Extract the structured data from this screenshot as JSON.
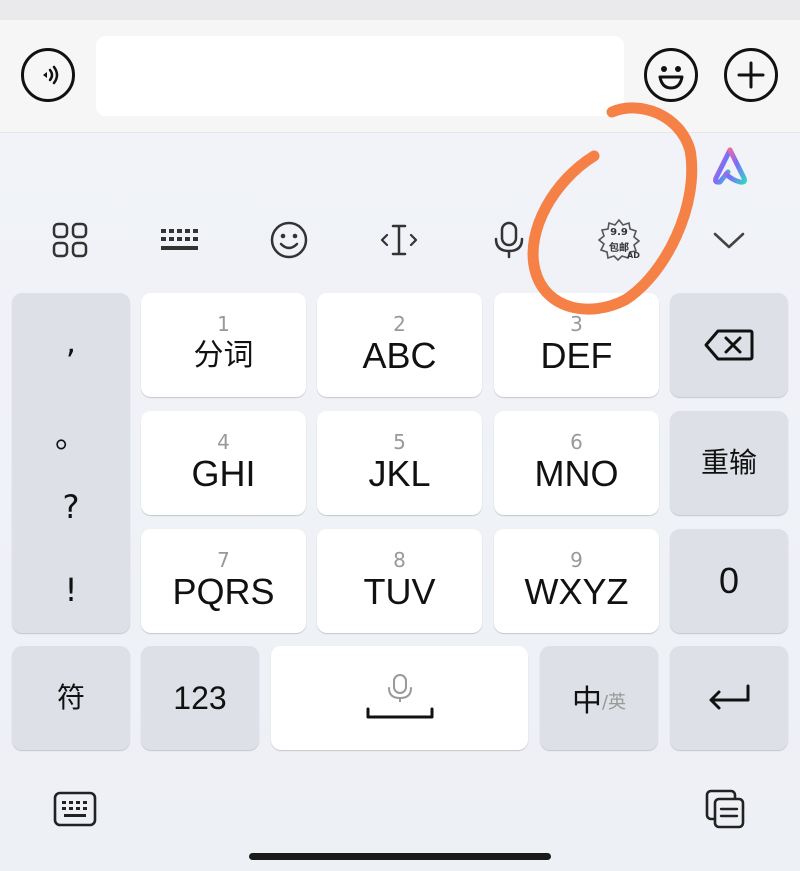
{
  "input_bar": {
    "voice_label": "",
    "text_value": ""
  },
  "toolbar": {
    "icons": [
      "grid-icon",
      "keyboard-icon",
      "emoji-icon",
      "cursor-icon",
      "microphone-icon",
      "promo-badge-icon",
      "chevron-down-icon"
    ],
    "promo": {
      "price": "9.9",
      "text": "包邮",
      "ad": "AD"
    }
  },
  "keys": {
    "fenci": {
      "num": "1",
      "label": "分词"
    },
    "abc": {
      "num": "2",
      "label": "ABC"
    },
    "def": {
      "num": "3",
      "label": "DEF"
    },
    "ghi": {
      "num": "4",
      "label": "GHI"
    },
    "jkl": {
      "num": "5",
      "label": "JKL"
    },
    "mno": {
      "num": "6",
      "label": "MNO"
    },
    "pqrs": {
      "num": "7",
      "label": "PQRS"
    },
    "tuv": {
      "num": "8",
      "label": "TUV"
    },
    "wxyz": {
      "num": "9",
      "label": "WXYZ"
    },
    "reinput": {
      "label": "重输"
    },
    "zero": {
      "label": "0"
    },
    "symbols": {
      "label": "符"
    },
    "num123": {
      "label": "123"
    },
    "lang": {
      "main": "中",
      "sub": "/英"
    }
  },
  "punctuation": [
    ",",
    "。",
    "?",
    "!"
  ],
  "colors": {
    "annotation": "#f47a3c",
    "assistant_grad": [
      "#ff6a8a",
      "#7b6cff",
      "#35d0c7"
    ]
  }
}
